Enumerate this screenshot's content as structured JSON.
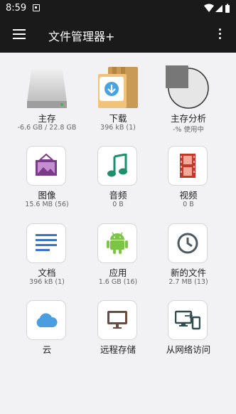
{
  "status": {
    "time": "8:59"
  },
  "appbar": {
    "title": "文件管理器+"
  },
  "tiles": [
    {
      "label": "主存",
      "sub": "-6.6 GB / 22.8 GB"
    },
    {
      "label": "下载",
      "sub": "396 kB (1)"
    },
    {
      "label": "主存分析",
      "sub": "-% 使用中"
    },
    {
      "label": "图像",
      "sub": "15.6 MB (56)"
    },
    {
      "label": "音频",
      "sub": "0 B"
    },
    {
      "label": "视频",
      "sub": "0 B"
    },
    {
      "label": "文档",
      "sub": "396 kB (1)"
    },
    {
      "label": "应用",
      "sub": "1.6 GB (16)"
    },
    {
      "label": "新的文件",
      "sub": "2.7 MB (13)"
    },
    {
      "label": "云"
    },
    {
      "label": "远程存储"
    },
    {
      "label": "从网络访问"
    }
  ],
  "icons": {
    "storage": "hard-drive-icon",
    "downloads": "download-folder-icon",
    "analysis": "pie-chart-icon",
    "images": "image-icon",
    "audio": "music-note-icon",
    "video": "film-icon",
    "documents": "document-lines-icon",
    "apps": "android-icon",
    "recent": "clock-icon",
    "cloud": "cloud-icon",
    "remote": "monitor-icon",
    "network": "network-devices-icon"
  },
  "colors": {
    "appbar": "#1a1a1a",
    "image": "#7b3a8a",
    "audio": "#1e8f6d",
    "video": "#c0392b",
    "document": "#3a73c7",
    "android": "#7cc544",
    "clock": "#4b5a63",
    "cloud": "#4a9ee0",
    "remote": "#6d4b3f",
    "network": "#2f4d4d"
  }
}
